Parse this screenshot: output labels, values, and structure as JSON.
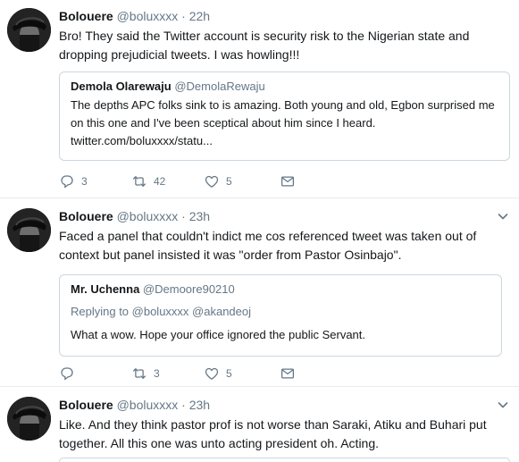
{
  "tweets": [
    {
      "name": "Bolouere",
      "handle": "@boluxxxx",
      "sep": "·",
      "time": "22h",
      "text": "Bro! They said the Twitter account is security risk to the Nigerian state and dropping prejudicial tweets. I was howling!!!",
      "quote": {
        "name": "Demola Olarewaju",
        "handle": "@DemolaRewaju",
        "text": "The depths APC folks sink to is amazing. Both young and old, Egbon surprised me on this one and I've been sceptical about him since I heard. twitter.com/boluxxxx/statu..."
      },
      "replies": "3",
      "retweets": "42",
      "likes": "5"
    },
    {
      "name": "Bolouere",
      "handle": "@boluxxxx",
      "sep": "·",
      "time": "23h",
      "text": "Faced a panel that couldn't indict me cos referenced tweet was taken out of context but panel insisted it was \"order from Pastor Osinbajo\".",
      "quote": {
        "name": "Mr. Uchenna",
        "handle": "@Demoore90210",
        "replying": "Replying to @boluxxxx @akandeoj",
        "text": "What a wow. Hope your office ignored the public Servant."
      },
      "replies": "",
      "retweets": "3",
      "likes": "5"
    },
    {
      "name": "Bolouere",
      "handle": "@boluxxxx",
      "sep": "·",
      "time": "23h",
      "text": "Like. And they think pastor prof is not worse than Saraki, Atiku and Buhari put together. All this one was unto acting president oh. Acting."
    }
  ],
  "icons": {
    "reply": "reply-icon",
    "retweet": "retweet-icon",
    "like": "heart-icon",
    "dm": "envelope-icon",
    "caret": "chevron-down-icon"
  },
  "colors": {
    "text": "#14171a",
    "muted": "#657786",
    "border": "#e6ecf0",
    "quote_border": "#ccd6dd"
  }
}
